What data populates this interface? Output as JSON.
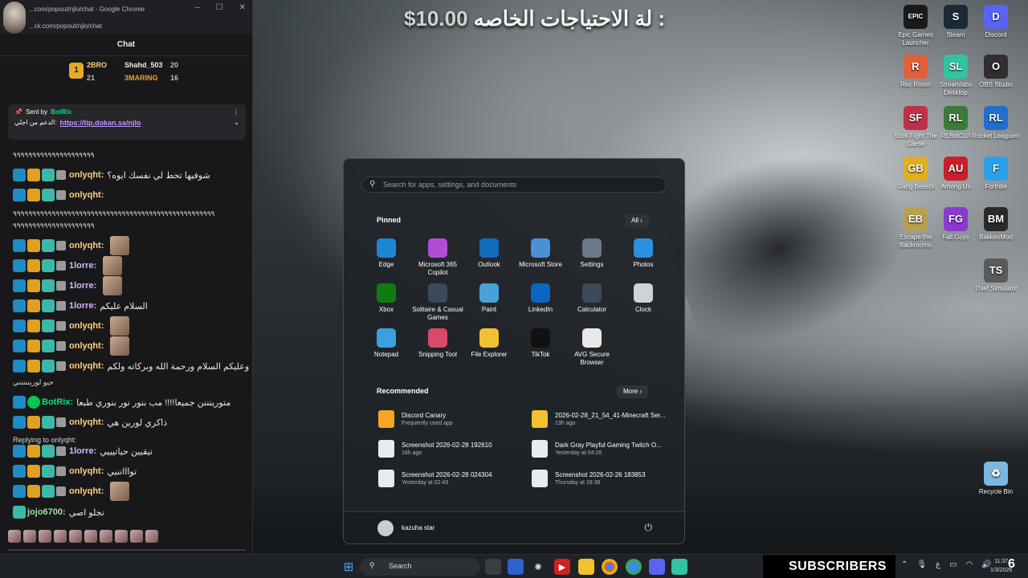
{
  "donation": {
    "name": "لة الاحتياجات الخاصه :",
    "price": "$10.00"
  },
  "chat_window": {
    "title": "...com/popout/njlo/chat - Google Chrome",
    "url": "...ck.com/popout/njlo/chat",
    "header": "Chat",
    "leaderboard": [
      {
        "name": "2BRO",
        "value": "21"
      },
      {
        "name": "Shahd_503",
        "value": "20"
      },
      {
        "name": "3MARING",
        "value": "16"
      }
    ],
    "pinned": {
      "sent_by": "Sent by",
      "sender": "BotRix",
      "text": "الدعم من اجلي:",
      "link": "https://tip.dokan.sa/njlo"
    },
    "messages": [
      {
        "raw": "٩٩٩٩٩٩٩٩٩٩٩٩٩٩٩٩٩٩٩٩٩"
      },
      {
        "user": "onlyqht:",
        "text": "شوفيها تحط لي نفسك ايوه؟"
      },
      {
        "user": "onlyqht:",
        "text": ""
      },
      {
        "raw": "٩٩٩٩٩٩٩٩٩٩٩٩٩٩٩٩٩٩٩٩٩٩٩٩٩٩٩٩٩٩٩٩٩٩٩٩٩٩٩٩٩٩٩٩٩٩٩٩٩٩٩٩"
      },
      {
        "raw": "٩٩٩٩٩٩٩٩٩٩٩٩٩٩٩٩٩٩٩٩٩"
      },
      {
        "user": "onlyqht:",
        "text": ""
      },
      {
        "user": "1lorre:",
        "text": ""
      },
      {
        "user": "1lorre:",
        "text": ""
      },
      {
        "user": "1lorre:",
        "text": "السلام عليكم"
      },
      {
        "user": "onlyqht:",
        "text": ""
      },
      {
        "user": "onlyqht:",
        "text": ""
      },
      {
        "user": "onlyqht:",
        "text": "وعليكم السلام ورحمة الله وبركاته ولكم"
      },
      {
        "raw": "حيو لوريننننني"
      },
      {
        "user": "BotRix:",
        "text": "متورينننن جميعا!!!! مب بنور نور بنوري طبعا"
      },
      {
        "user": "onlyqht:",
        "text": "ذاكري لورين هي"
      },
      {
        "raw": "Replying to onlyqht:"
      },
      {
        "user": "1lorre:",
        "text": "تيقيين حياتيييي"
      },
      {
        "user": "onlyqht:",
        "text": "تواااننيي"
      },
      {
        "user": "onlyqht:",
        "text": ""
      },
      {
        "user": "jojo6700:",
        "text": "نجلو اصي"
      }
    ]
  },
  "start_menu": {
    "search_placeholder": "Search for apps, settings, and documents",
    "pinned_label": "Pinned",
    "all_label": "All",
    "apps": [
      {
        "label": "Edge",
        "icon": "edge-icon",
        "color": "#1b88d3"
      },
      {
        "label": "Microsoft 365 Copilot",
        "icon": "copilot-icon",
        "color": "#b34bd6"
      },
      {
        "label": "Outlook",
        "icon": "outlook-icon",
        "color": "#0f6cbd"
      },
      {
        "label": "Microsoft Store",
        "icon": "store-icon",
        "color": "#4a90d9"
      },
      {
        "label": "Settings",
        "icon": "gear-icon",
        "color": "#6b7885"
      },
      {
        "label": "Photos",
        "icon": "photos-icon",
        "color": "#2c8fe0"
      },
      {
        "label": "Xbox",
        "icon": "xbox-icon",
        "color": "#107c10"
      },
      {
        "label": "Solitaire & Casual Games",
        "icon": "cards-icon",
        "color": "#3a4a5a"
      },
      {
        "label": "Paint",
        "icon": "paint-icon",
        "color": "#4aa0d8"
      },
      {
        "label": "LinkedIn",
        "icon": "linkedin-icon",
        "color": "#0a66c2"
      },
      {
        "label": "Calculator",
        "icon": "calculator-icon",
        "color": "#3d4a57"
      },
      {
        "label": "Clock",
        "icon": "clock-icon",
        "color": "#cfd3d6"
      },
      {
        "label": "Notepad",
        "icon": "notepad-icon",
        "color": "#3aa0e0"
      },
      {
        "label": "Snipping Tool",
        "icon": "scissors-icon",
        "color": "#d84a6a"
      },
      {
        "label": "File Explorer",
        "icon": "folder-icon",
        "color": "#f2c030"
      },
      {
        "label": "TikTok",
        "icon": "tiktok-icon",
        "color": "#111111"
      },
      {
        "label": "AVG Secure Browser",
        "icon": "avg-icon",
        "color": "#e8e8e8"
      }
    ],
    "recommended_label": "Recommended",
    "more_label": "More",
    "recommended": [
      {
        "title": "Discord Canary",
        "sub": "Frequently used app",
        "color": "#f5a623"
      },
      {
        "title": "2026-02-28_21_54_41-Minecraft Ser...",
        "sub": "13h ago",
        "color": "#f2c030"
      },
      {
        "title": "Screenshot 2026-02-28 192610",
        "sub": "16h ago",
        "color": "#e6ecf2"
      },
      {
        "title": "Dark Gray Playful Gaming Twitch O...",
        "sub": "Yesterday at 04:28",
        "color": "#e6ecf2"
      },
      {
        "title": "Screenshot 2026-02-28 024304",
        "sub": "Yesterday at 02:43",
        "color": "#e6ecf2"
      },
      {
        "title": "Screenshot 2026-02-26 183853",
        "sub": "Thursday at 18:38",
        "color": "#e6ecf2"
      }
    ],
    "user_name": "kazuha star"
  },
  "desktop_icons": [
    {
      "label": "Epic Games Launcher",
      "glyph": "EPIC",
      "color": "#1a1a1a"
    },
    {
      "label": "Steam",
      "glyph": "S",
      "color": "#1b2838"
    },
    {
      "label": "Discord",
      "glyph": "D",
      "color": "#5865f2"
    },
    {
      "label": "Rec Room",
      "glyph": "R",
      "color": "#e0603a"
    },
    {
      "label": "Streamlabs Desktop",
      "glyph": "SL",
      "color": "#31c3a2"
    },
    {
      "label": "OBS Studio",
      "glyph": "O",
      "color": "#302e31"
    },
    {
      "label": "Stick Fight The Game",
      "glyph": "SF",
      "color": "#c03048"
    },
    {
      "label": "RLBotGUI",
      "glyph": "RL",
      "color": "#3a7a3a"
    },
    {
      "label": "Rocket League®",
      "glyph": "RL",
      "color": "#1f6fd0"
    },
    {
      "label": "Gang Beasts",
      "glyph": "GB",
      "color": "#e0b020"
    },
    {
      "label": "Among Us",
      "glyph": "AU",
      "color": "#c8202a"
    },
    {
      "label": "Fortnite",
      "glyph": "F",
      "color": "#2aa0e8"
    },
    {
      "label": "Escape the Backrooms",
      "glyph": "EB",
      "color": "#b8a050"
    },
    {
      "label": "Fall Guys",
      "glyph": "FG",
      "color": "#8a3ad0"
    },
    {
      "label": "BakkesMod",
      "glyph": "BM",
      "color": "#2a2a2a"
    },
    {
      "label": "Thief Simulator",
      "glyph": "TS",
      "color": "#5a5a5a"
    },
    {
      "label": "Recycle Bin",
      "glyph": "♻",
      "color": "#7ab8e0"
    }
  ],
  "taskbar": {
    "search_label": "Search",
    "subscribers_label": "SUBSCRIBERS",
    "time": "11:37",
    "date": "1/3/2026",
    "notif_count": "6"
  }
}
